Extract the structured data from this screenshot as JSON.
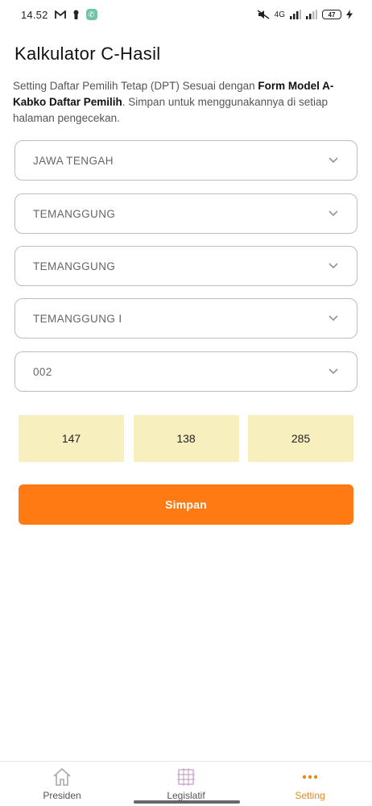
{
  "status_bar": {
    "time": "14.52",
    "network": "4G",
    "battery": "47"
  },
  "header": {
    "title": "Kalkulator C-Hasil",
    "description_prefix": "Setting Daftar Pemilih Tetap (DPT) Sesuai dengan ",
    "description_bold": "Form Model A-Kabko Daftar Pemilih",
    "description_suffix": ". Simpan untuk menggunakannya di setiap halaman pengecekan."
  },
  "selects": [
    {
      "value": "JAWA TENGAH"
    },
    {
      "value": "TEMANGGUNG"
    },
    {
      "value": "TEMANGGUNG"
    },
    {
      "value": "TEMANGGUNG I"
    },
    {
      "value": "002"
    }
  ],
  "counts": [
    "147",
    "138",
    "285"
  ],
  "save_label": "Simpan",
  "nav": {
    "items": [
      {
        "label": "Presiden",
        "icon": "home-icon"
      },
      {
        "label": "Legislatif",
        "icon": "grid-icon"
      },
      {
        "label": "Setting",
        "icon": "more-dots-icon",
        "active": true
      }
    ]
  },
  "colors": {
    "accent": "#ff7a12",
    "nav_active": "#e8871a",
    "count_bg": "#f8efbf"
  }
}
